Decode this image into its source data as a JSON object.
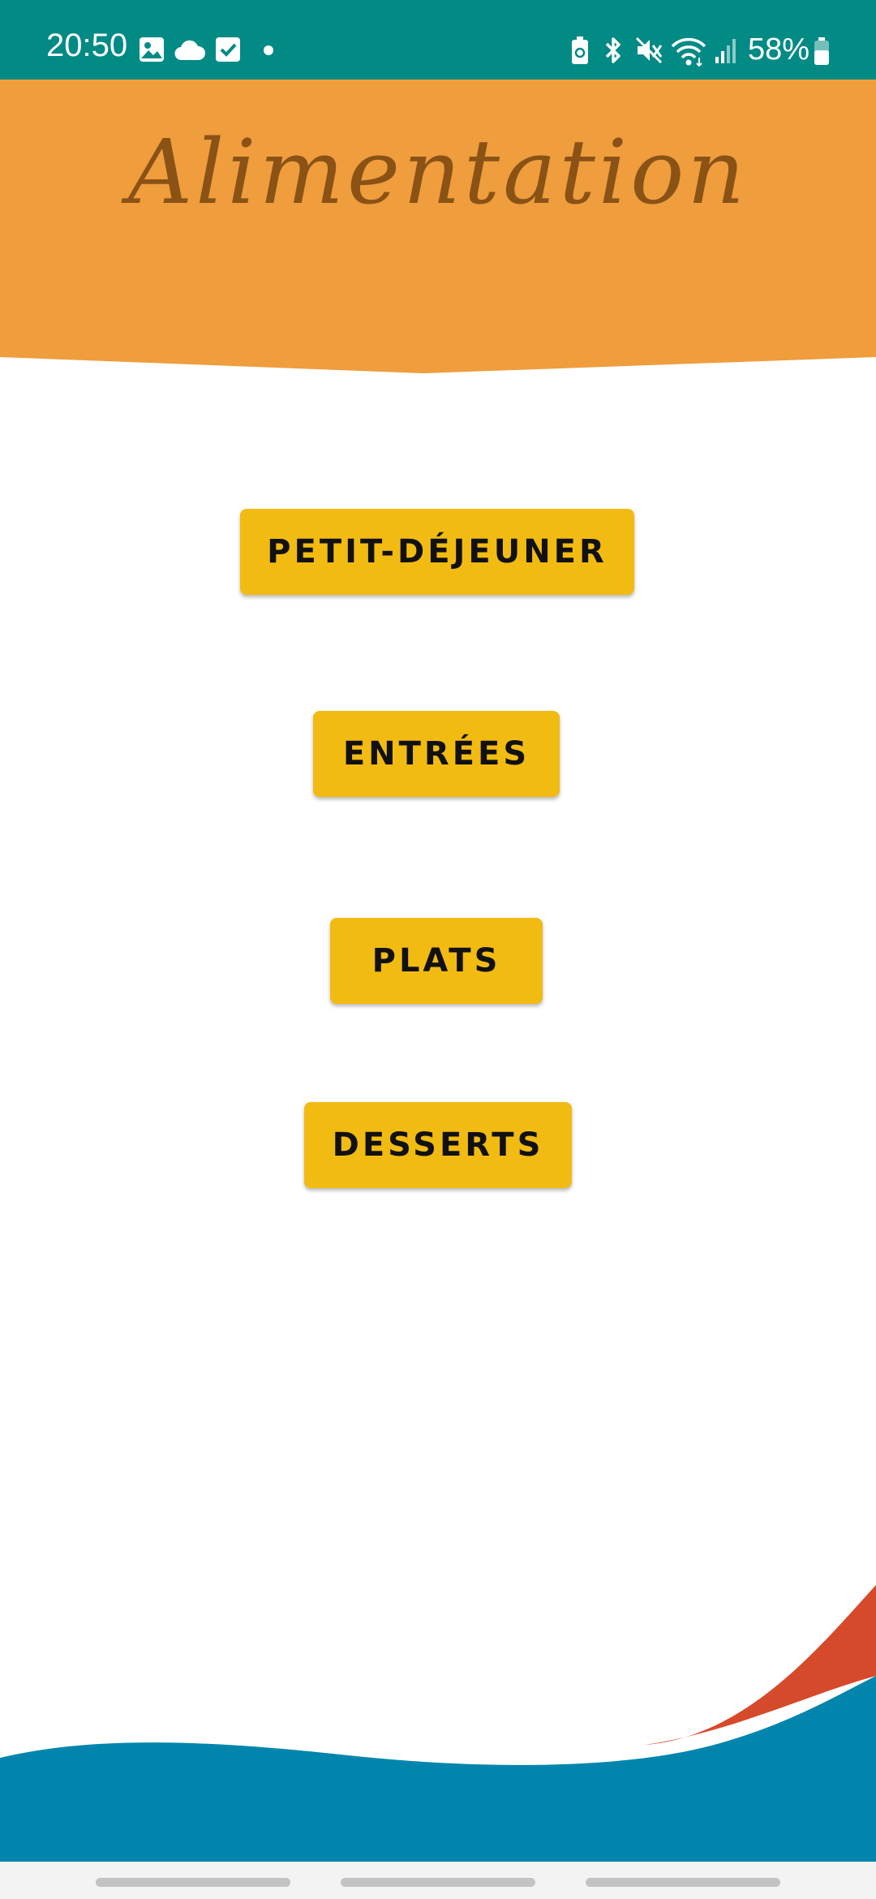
{
  "status_bar": {
    "time": "20:50",
    "battery": "58%",
    "background_color": "#028a85",
    "left_icons": [
      "gallery-icon",
      "cloud-icon",
      "checkbox-icon",
      "dot-icon"
    ],
    "right_icons": [
      "battery-saver-icon",
      "bluetooth-icon",
      "mute-icon",
      "wifi-icon",
      "signal-icon",
      "battery-icon"
    ]
  },
  "header": {
    "title": "Alimentation",
    "background_color": "#ef9d3d",
    "title_color": "#8a5215"
  },
  "menu": {
    "button_color": "#f2bb12",
    "buttons": [
      {
        "label": "PETIT-DÉJEUNER"
      },
      {
        "label": "ENTRÉES"
      },
      {
        "label": "PLATS"
      },
      {
        "label": "DESSERTS"
      }
    ]
  },
  "decoration": {
    "wave_color": "#0185ad",
    "swoosh_color": "#d64a2c"
  }
}
